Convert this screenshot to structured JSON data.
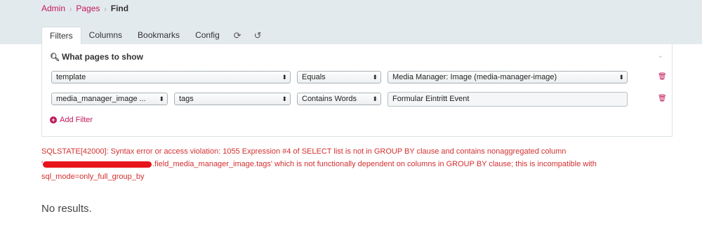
{
  "breadcrumb": {
    "admin": "Admin",
    "pages": "Pages",
    "current": "Find"
  },
  "tabs": {
    "filters": "Filters",
    "columns": "Columns",
    "bookmarks": "Bookmarks",
    "config": "Config"
  },
  "panel": {
    "title": "What pages to show",
    "add_filter": "Add Filter"
  },
  "filters": [
    {
      "field": "template",
      "operator": "Equals",
      "value": "Media Manager: Image (media-manager-image)"
    },
    {
      "field": "media_manager_image ...",
      "subfield": "tags",
      "operator": "Contains Words",
      "value": "Formular Eintritt Event"
    }
  ],
  "error": {
    "line1": "SQLSTATE[42000]: Syntax error or access violation: 1055 Expression #4 of SELECT list is not in GROUP BY clause and contains nonaggregated column",
    "line2_prefix": "'",
    "line2_rest": ".field_media_manager_image.tags' which is not functionally dependent on columns in GROUP BY clause; this is incompatible with",
    "line3": "sql_mode=only_full_group_by"
  },
  "results": {
    "message": "No results."
  },
  "colors": {
    "accent": "#c2185b",
    "error": "#d32f2f",
    "topbar": "#e3eaee"
  }
}
